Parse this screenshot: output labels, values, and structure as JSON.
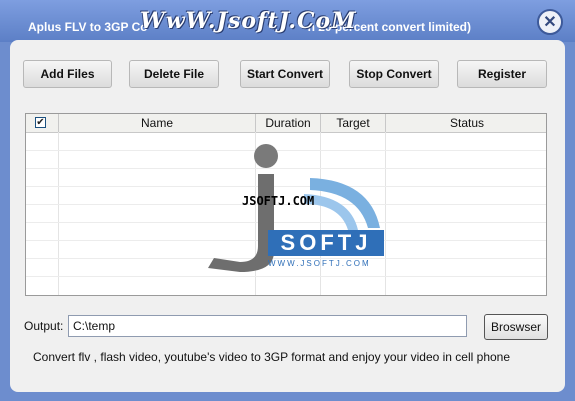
{
  "window": {
    "title": "Aplus FLV to 3GP Co",
    "title_suffix": "n 20 percent convert limited)",
    "watermark": "WwW.JsoftJ.CoM",
    "close_symbol": "✕"
  },
  "toolbar": {
    "add_files": "Add Files",
    "delete_file": "Delete File",
    "start_convert": "Start Convert",
    "stop_convert": "Stop Convert",
    "register": "Register"
  },
  "grid": {
    "checkbox_checked": "✔",
    "columns": [
      "Name",
      "Duration",
      "Target",
      "Status"
    ],
    "rows": []
  },
  "logo": {
    "url_text": "JSOFTJ.COM",
    "word": "SOFTJ",
    "small_text": "WWW.JSOFTJ.COM"
  },
  "output": {
    "label": "Output:",
    "value": "C:\\temp",
    "browse_label": "Broswser"
  },
  "footer": {
    "text": "Convert flv , flash video, youtube's video to 3GP format and enjoy your video in cell phone"
  }
}
